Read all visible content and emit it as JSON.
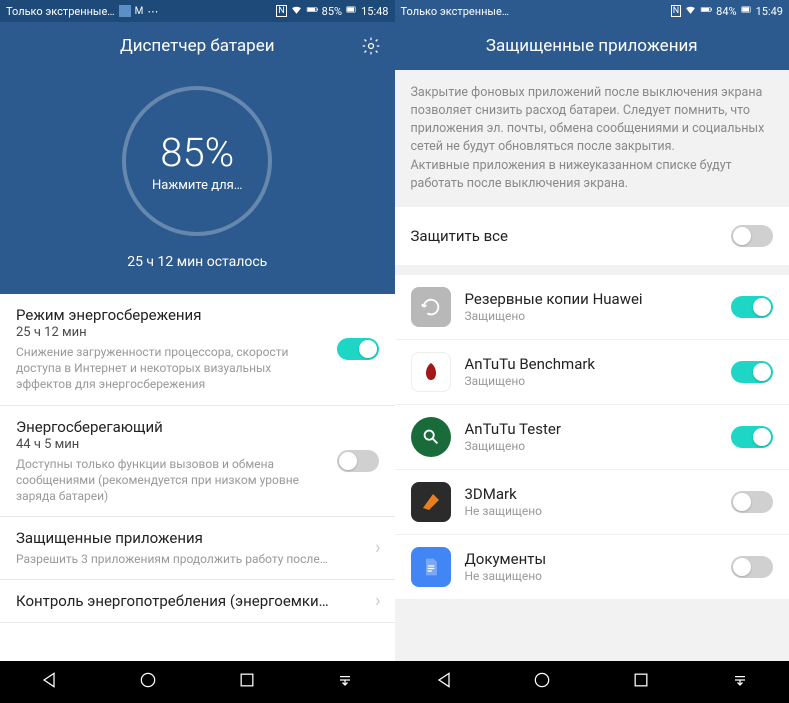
{
  "left": {
    "status": {
      "carrier": "Только экстренные…",
      "nfc": "NFC",
      "battery": "85%",
      "time": "15:48"
    },
    "title": "Диспетчер батареи",
    "circle": {
      "pct": "85%",
      "tap": "Нажмите для…"
    },
    "remaining": "25 ч 12 мин осталось",
    "rows": [
      {
        "title": "Режим энергосбережения",
        "sub": "25 ч 12 мин",
        "desc": "Снижение загруженности процессора, скорости доступа в Интернет и некоторых визуальных эффектов для энергосбережения",
        "toggle": true
      },
      {
        "title": "Энергосберегающий",
        "sub": "44 ч 5 мин",
        "desc": "Доступны только функции вызовов и обмена сообщениями (рекомендуется при низком уровне заряда батареи)",
        "toggle": false
      },
      {
        "title": "Защищенные приложения",
        "desc": "Разрешить 3 приложениям продолжить работу после…",
        "chev": true
      },
      {
        "title": "Контроль энергопотребления (энергоемки…",
        "chev": true
      }
    ]
  },
  "right": {
    "status": {
      "carrier": "Только экстренные…",
      "nfc": "NFC",
      "battery": "84%",
      "time": "15:49"
    },
    "title": "Защищенные приложения",
    "info": "Закрытие фоновых приложений после выключения экрана позволяет снизить расход батареи. Следует помнить, что приложения эл. почты, обмена сообщениями и социальных сетей не будут обновляться после закрытия.\nАктивные приложения в нижеуказанном списке будут работать после выключения экрана.",
    "protectAll": "Защитить все",
    "apps": [
      {
        "name": "Резервные копии Huawei",
        "status": "Защищено",
        "color": "#b8b8b8",
        "on": true
      },
      {
        "name": "AnTuTu Benchmark",
        "status": "Защищено",
        "color": "#fff",
        "on": true
      },
      {
        "name": "AnTuTu Tester",
        "status": "Защищено",
        "color": "#1a6b3a",
        "on": true
      },
      {
        "name": "3DMark",
        "status": "Не защищено",
        "color": "#2b2b2b",
        "on": false
      },
      {
        "name": "Документы",
        "status": "Не защищено",
        "color": "#4285f4",
        "on": false
      }
    ]
  }
}
